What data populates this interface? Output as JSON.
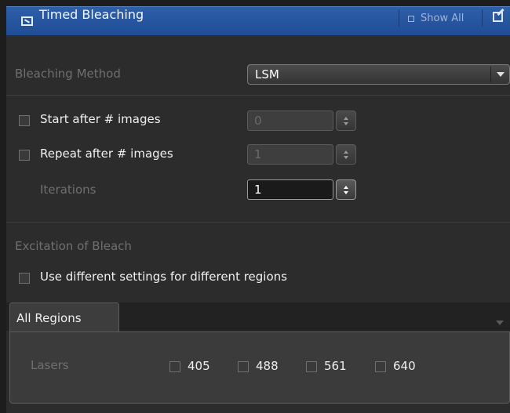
{
  "header": {
    "title": "Timed Bleaching",
    "show_all": "Show All",
    "icons": [
      "checkbox-icon",
      "show-all-square-icon",
      "edit-icon"
    ]
  },
  "bleaching": {
    "method_label": "Bleaching Method",
    "method_value": "LSM"
  },
  "start_after": {
    "label": "Start after # images",
    "value": "0",
    "checked": false
  },
  "repeat_after": {
    "label": "Repeat after # images",
    "value": "1",
    "checked": false
  },
  "iterations": {
    "label": "Iterations",
    "value": "1"
  },
  "excitation": {
    "section_label": "Excitation of Bleach",
    "different_settings_label": "Use different settings for different regions",
    "different_settings_checked": false
  },
  "regions": {
    "tab_label": "All Regions",
    "lasers_label": "Lasers",
    "lasers": [
      {
        "label": "405",
        "checked": false
      },
      {
        "label": "488",
        "checked": false
      },
      {
        "label": "561",
        "checked": false
      },
      {
        "label": "640",
        "checked": false
      }
    ]
  }
}
